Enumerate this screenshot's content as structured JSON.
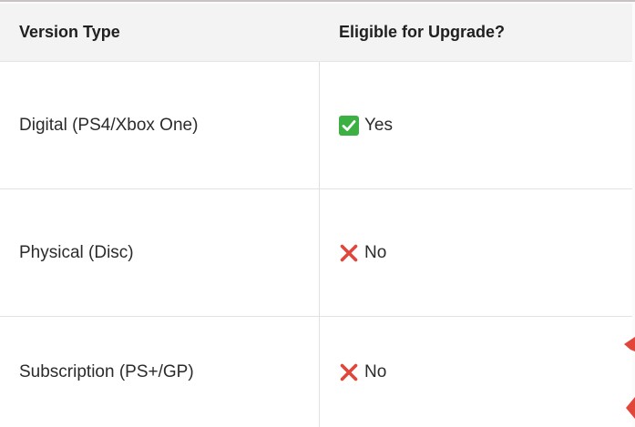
{
  "table": {
    "headers": [
      "Version Type",
      "Eligible for Upgrade?"
    ],
    "rows": [
      {
        "version": "Digital (PS4/Xbox One)",
        "status": "Yes",
        "icon": "check-mark-icon",
        "icon_color": "#3cb043"
      },
      {
        "version": "Physical (Disc)",
        "status": "No",
        "icon": "cross-mark-icon",
        "icon_color": "#e0463a"
      },
      {
        "version": "Subscription (PS+/GP)",
        "status": "No",
        "icon": "cross-mark-icon",
        "icon_color": "#e0463a"
      }
    ]
  },
  "colors": {
    "header_bg": "#f3f3f3",
    "check_green": "#3cb043",
    "cross_red": "#e0463a",
    "edge_accent": "#e0463a"
  }
}
